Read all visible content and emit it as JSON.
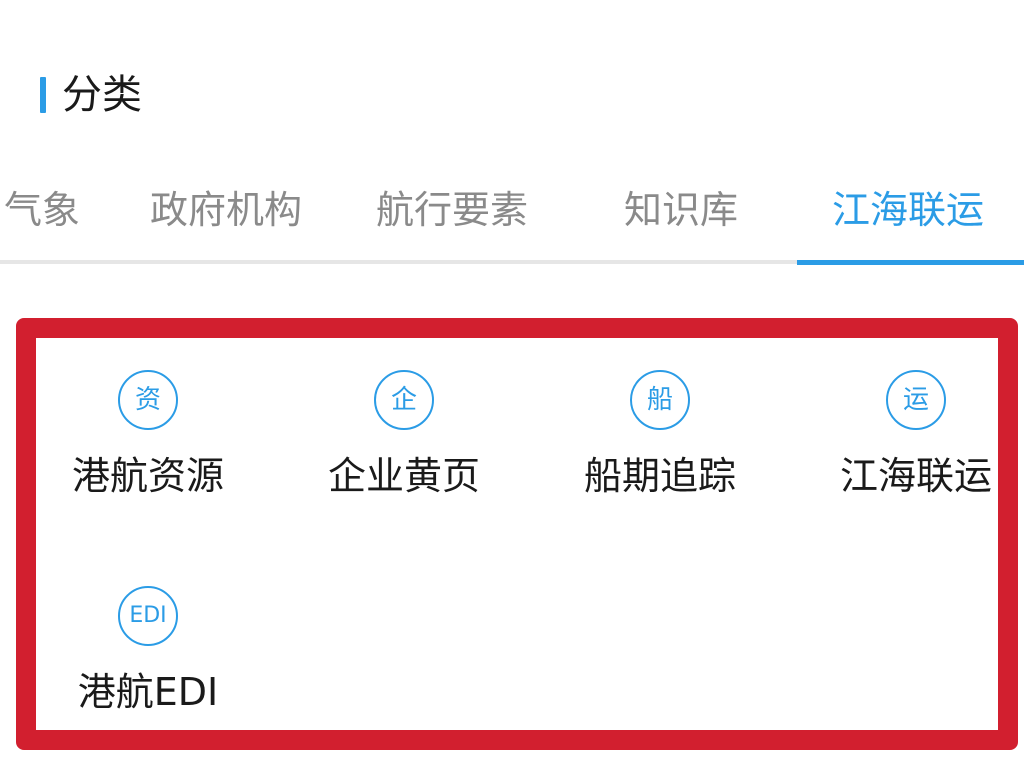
{
  "section": {
    "title": "分类",
    "accent_color": "#2b9ce6"
  },
  "tabs": [
    {
      "label": "气象",
      "active": false
    },
    {
      "label": "政府机构",
      "active": false
    },
    {
      "label": "航行要素",
      "active": false
    },
    {
      "label": "知识库",
      "active": false
    },
    {
      "label": "江海联运",
      "active": true
    }
  ],
  "grid": {
    "highlight_color": "#d21f2f",
    "items": [
      {
        "icon_text": "资",
        "label": "港航资源"
      },
      {
        "icon_text": "企",
        "label": "企业黄页"
      },
      {
        "icon_text": "船",
        "label": "船期追踪"
      },
      {
        "icon_text": "运",
        "label": "江海联运"
      },
      {
        "icon_text": "EDI",
        "label": "港航EDI"
      }
    ]
  }
}
